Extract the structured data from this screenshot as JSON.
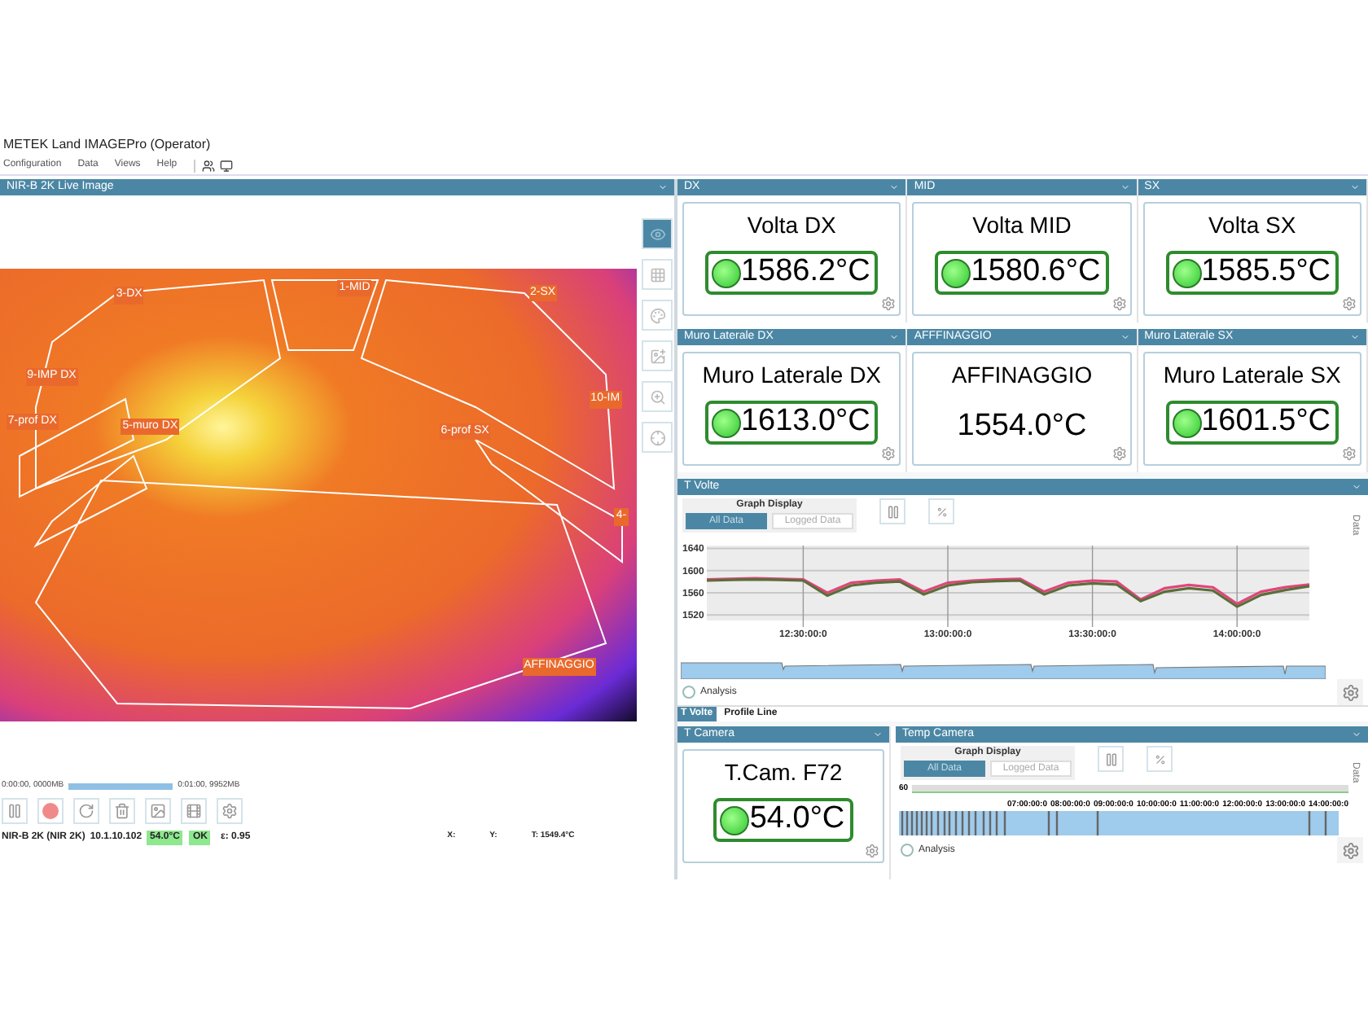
{
  "window": {
    "title": "METEK Land IMAGEPro (Operator)"
  },
  "menu": [
    "Configuration",
    "Data",
    "Views",
    "Help"
  ],
  "live_image": {
    "title": "NIR-B 2K Live Image",
    "regions": [
      {
        "label": "3-DX"
      },
      {
        "label": "1-MID"
      },
      {
        "label": "2-SX"
      },
      {
        "label": "9-IMP DX"
      },
      {
        "label": "7-prof DX"
      },
      {
        "label": "5-muro DX"
      },
      {
        "label": "6-prof SX"
      },
      {
        "label": "10-IM"
      },
      {
        "label": "4-"
      },
      {
        "label": "AFFINAGGIO"
      }
    ],
    "tools": [
      {
        "kind": "eye",
        "selected": true
      },
      {
        "kind": "grid",
        "selected": false
      },
      {
        "kind": "palette",
        "selected": false
      },
      {
        "kind": "image",
        "selected": false
      },
      {
        "kind": "zoom",
        "selected": false
      },
      {
        "kind": "crosshair",
        "selected": false
      }
    ]
  },
  "recording": {
    "start": "0:00:00, 0000MB",
    "end": "0:01:00, 9952MB"
  },
  "status": {
    "camera": "NIR-B 2K (NIR 2K)",
    "ip": "10.1.10.102",
    "camera_temp": "54.0°C",
    "state": "OK",
    "emissivity": "ε: 0.95",
    "x": "X:",
    "y": "Y:",
    "t": "T: 1549.4°C"
  },
  "readouts": [
    {
      "header": "DX",
      "title": "Volta DX",
      "value": "1586.2°C",
      "indicator": true
    },
    {
      "header": "MID",
      "title": "Volta MID",
      "value": "1580.6°C",
      "indicator": true
    },
    {
      "header": "SX",
      "title": "Volta SX",
      "value": "1585.5°C",
      "indicator": true
    },
    {
      "header": "Muro Laterale DX",
      "title": "Muro Laterale DX",
      "value": "1613.0°C",
      "indicator": true
    },
    {
      "header": "AFFFINAGGIO",
      "title": "AFFINAGGIO",
      "value": "1554.0°C",
      "indicator": false
    },
    {
      "header": "Muro Laterale SX",
      "title": "Muro Laterale SX",
      "value": "1601.5°C",
      "indicator": true
    }
  ],
  "t_volte": {
    "title": "T Volte",
    "graph_display": {
      "label": "Graph Display",
      "options": [
        {
          "label": "All Data",
          "selected": true
        },
        {
          "label": "Logged Data",
          "selected": false
        }
      ]
    },
    "side_label": "Data",
    "analysis": "Analysis",
    "chart_data": {
      "type": "line",
      "categories": [
        null,
        null,
        null,
        null,
        "12:30:00:0",
        null,
        null,
        null,
        null,
        null,
        "13:00:00:0",
        null,
        null,
        null,
        null,
        null,
        "13:30:00:0",
        null,
        null,
        null,
        null,
        null,
        "14:00:00:0",
        null,
        null,
        null
      ],
      "series": [
        {
          "color": "#e0457b",
          "values": [
            1584,
            1585,
            1586,
            1585,
            1584,
            1560,
            1578,
            1582,
            1584,
            1562,
            1578,
            1582,
            1584,
            1585,
            1562,
            1578,
            1582,
            1580,
            1548,
            1568,
            1574,
            1570,
            1540,
            1562,
            1570,
            1575
          ]
        },
        {
          "color": "#5a6e3a",
          "values": [
            1582,
            1583,
            1584,
            1583,
            1582,
            1555,
            1573,
            1578,
            1580,
            1557,
            1573,
            1579,
            1581,
            1582,
            1557,
            1573,
            1577,
            1575,
            1545,
            1562,
            1568,
            1564,
            1535,
            1556,
            1565,
            1572
          ]
        }
      ],
      "ylim": [
        1510,
        1645
      ],
      "yticks": [
        1520,
        1560,
        1600,
        1640
      ],
      "grid": true
    }
  },
  "bottom_tabs": [
    {
      "label": "T Volte",
      "selected": true
    },
    {
      "label": "Profile Line",
      "selected": false
    }
  ],
  "t_camera": {
    "header": "T Camera",
    "title": "T.Cam. F72",
    "value": "54.0°C",
    "indicator": true
  },
  "temp_camera": {
    "title": "Temp Camera",
    "graph_display": {
      "label": "Graph Display",
      "options": [
        {
          "label": "All Data",
          "selected": true
        },
        {
          "label": "Logged Data",
          "selected": false
        }
      ]
    },
    "side_label": "Data",
    "scale_label": "60",
    "time_labels": [
      "07:00:00:0",
      "08:00:00:0",
      "09:00:00:0",
      "10:00:00:0",
      "11:00:00:0",
      "12:00:00:0",
      "13:00:00:0",
      "14:00:00:0"
    ],
    "analysis": "Analysis"
  }
}
